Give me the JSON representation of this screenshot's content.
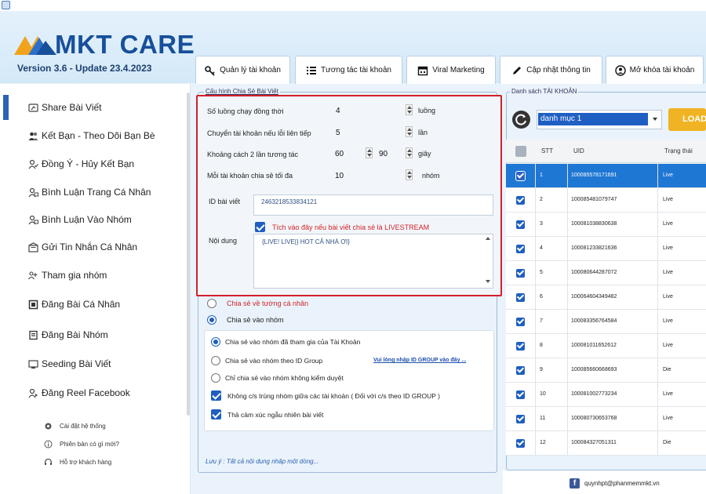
{
  "app": {
    "logo_text": "MKT CARE",
    "version": "Version 3.6 - Update 23.4.2023",
    "brand_color": "#174f9b"
  },
  "tabs": [
    {
      "label": "Quản lý tài khoản",
      "icon": "key-icon"
    },
    {
      "label": "Tương tác tài khoản",
      "icon": "list-icon"
    },
    {
      "label": "Viral Marketing",
      "icon": "calendar-icon"
    },
    {
      "label": "Cập nhật thông tin",
      "icon": "pen-icon"
    },
    {
      "label": "Mở khóa tài khoản",
      "icon": "user-circle-icon"
    }
  ],
  "sidebar": {
    "items": [
      {
        "label": "Share Bài Viết",
        "icon": "share-icon"
      },
      {
        "label": "Kết Bạn - Theo Dõi Bạn Bè",
        "icon": "friends-icon"
      },
      {
        "label": "Đồng Ý - Hủy Kết Bạn",
        "icon": "user-check-icon"
      },
      {
        "label": "Bình Luận Trang Cá Nhân",
        "icon": "comment-icon"
      },
      {
        "label": "Bình Luận Vào Nhóm",
        "icon": "group-comment-icon"
      },
      {
        "label": "Gửi Tin Nhắn Cá Nhân",
        "icon": "message-icon"
      },
      {
        "label": "Tham gia nhóm",
        "icon": "join-group-icon"
      },
      {
        "label": "Đăng Bài Cá Nhân",
        "icon": "book-icon"
      },
      {
        "label": "Đăng Bài Nhóm",
        "icon": "post-group-icon"
      },
      {
        "label": "Seeding Bài Viết",
        "icon": "seeding-icon"
      },
      {
        "label": "Đăng Reel Facebook",
        "icon": "reel-icon"
      }
    ],
    "sub_items": [
      {
        "label": "Cài đặt hệ thống",
        "icon": "gear-icon"
      },
      {
        "label": "Phiên bản có gì mới?",
        "icon": "info-icon"
      },
      {
        "label": "Hỗ trợ khách hàng",
        "icon": "support-icon"
      }
    ]
  },
  "config": {
    "title": "Cấu hình Chia Sẻ Bài Viết",
    "rows": [
      {
        "label": "Số luồng chạy đồng thời",
        "value": "4",
        "unit": "luồng"
      },
      {
        "label": "Chuyển tài khoản nếu lỗi liên tiếp",
        "value": "5",
        "unit": "lần"
      },
      {
        "label": "Khoảng cách 2 lần tương tác",
        "value": "60",
        "value2": "90",
        "unit": "giây"
      },
      {
        "label": "Mỗi tài khoản chia sẻ tối đa",
        "value": "10",
        "unit": "nhóm"
      }
    ],
    "post_id_label": "ID bài viết",
    "post_id_value": "2463218533834121",
    "livestream_checkbox": "Tích vào đây nếu bài viết chia sẻ là LIVESTREAM",
    "content_label": "Nội dung",
    "content_value": "{LIVE! LIVE|} HOT CẢ NHÀ ƠI}",
    "share_personal": "Chia sẻ về tường cá nhân",
    "share_group": "Chia sẻ vào nhóm",
    "opt_joined": "Chia sẻ vào nhóm đã tham gia của Tài Khoản",
    "opt_by_id": "Chia sẻ vào nhóm theo ID Group",
    "opt_by_id_link": "Vui lòng nhập ID GROUP vào đây ...",
    "opt_no_review": "Chỉ chia sẻ vào nhóm không kiểm duyệt",
    "opt_no_dup": "Không c/s trùng nhóm giữa các tài khoản ( Đối với c/s theo ID GROUP )",
    "opt_emotion": "Thả cảm xúc ngẫu nhiên bài viết",
    "note": "Lưu ý : Tất cả nội dung nhập một dòng..."
  },
  "accounts": {
    "title": "Danh sách TÀI KHOẢN",
    "category": "danh mục 1",
    "load_label": "LOAD",
    "columns": [
      "STT",
      "UID",
      "Trạng thái"
    ],
    "rows": [
      {
        "stt": "1",
        "uid": "100085578171691",
        "status": "Live"
      },
      {
        "stt": "2",
        "uid": "100085481079747",
        "status": "Live"
      },
      {
        "stt": "3",
        "uid": "100081038830638",
        "status": "Live"
      },
      {
        "stt": "4",
        "uid": "100081233821636",
        "status": "Live"
      },
      {
        "stt": "5",
        "uid": "100080644287072",
        "status": "Live"
      },
      {
        "stt": "6",
        "uid": "100064604349482",
        "status": "Live"
      },
      {
        "stt": "7",
        "uid": "100083356764584",
        "status": "Live"
      },
      {
        "stt": "8",
        "uid": "100081011652612",
        "status": "Live"
      },
      {
        "stt": "9",
        "uid": "100085660668693",
        "status": "Die"
      },
      {
        "stt": "10",
        "uid": "100081002773234",
        "status": "Live"
      },
      {
        "stt": "11",
        "uid": "100080730653768",
        "status": "Live"
      },
      {
        "stt": "12",
        "uid": "100084327051311",
        "status": "Die"
      }
    ]
  },
  "footer": {
    "email": "quynhpt@phanmemmkt.vn"
  }
}
